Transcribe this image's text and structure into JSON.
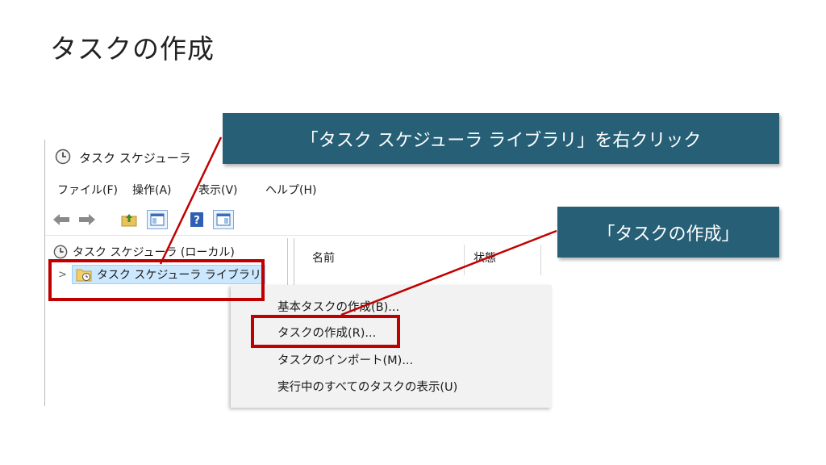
{
  "slide": {
    "title": "タスクの作成"
  },
  "window": {
    "title": "タスク スケジューラ",
    "menu": [
      "ファイル(F)",
      "操作(A)",
      "表示(V)",
      "ヘルプ(H)"
    ],
    "toolbar_icons": [
      "back-arrow-icon",
      "forward-arrow-icon",
      "folder-up-icon",
      "console-tree-icon",
      "help-icon",
      "action-pane-icon"
    ],
    "tree": {
      "root_label": "タスク スケジューラ (ローカル)",
      "library_label": "タスク スケジューラ ライブラリ"
    },
    "columns": [
      "名前",
      "状態"
    ]
  },
  "context_menu": {
    "items": [
      "基本タスクの作成(B)...",
      "タスクの作成(R)...",
      "タスクのインポート(M)...",
      "実行中のすべてのタスクの表示(U)"
    ]
  },
  "callouts": {
    "right_click": "「タスク スケジューラ ライブラリ」を右クリック",
    "create_task": "「タスクの作成」"
  },
  "colors": {
    "callout_bg": "#276076",
    "highlight": "#c00000"
  }
}
